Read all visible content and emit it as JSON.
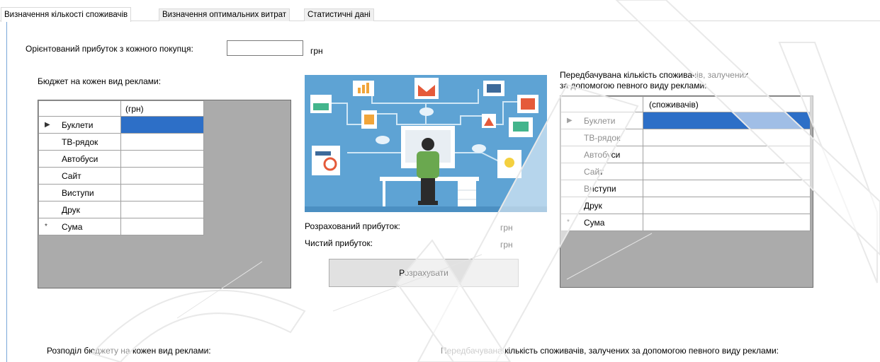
{
  "tabs": [
    {
      "label": "Визначення кількості споживачів",
      "active": true
    },
    {
      "label": "Визначення оптимальних витрат",
      "active": false
    },
    {
      "label": "Статистичні дані",
      "active": false
    }
  ],
  "profit_per_buyer": {
    "label": "Орієнтований прибуток з кожного покупця:",
    "value": "",
    "unit": "грн"
  },
  "budget_grid": {
    "title": "Бюджет на кожен вид реклами:",
    "column_header": "(грн)",
    "rows": [
      {
        "marker": "▶",
        "label": "Буклети",
        "value": "",
        "selected": true
      },
      {
        "marker": "",
        "label": "ТВ-рядок",
        "value": ""
      },
      {
        "marker": "",
        "label": "Автобуси",
        "value": ""
      },
      {
        "marker": "",
        "label": "Сайт",
        "value": ""
      },
      {
        "marker": "",
        "label": "Виступи",
        "value": ""
      },
      {
        "marker": "",
        "label": "Друк",
        "value": ""
      },
      {
        "marker": "*",
        "label": "Сума",
        "value": ""
      }
    ]
  },
  "consumers_grid": {
    "title_line1": "Передбачувана кількість споживачів, залучених",
    "title_line2": "за допомогою певного виду реклами:",
    "column_header": "(споживачів)",
    "rows": [
      {
        "marker": "▶",
        "label": "Буклети",
        "value": "",
        "selected": true
      },
      {
        "marker": "",
        "label": "ТВ-рядок",
        "value": ""
      },
      {
        "marker": "",
        "label": "Автобуси",
        "value": ""
      },
      {
        "marker": "",
        "label": "Сайт",
        "value": ""
      },
      {
        "marker": "",
        "label": "Виступи",
        "value": ""
      },
      {
        "marker": "",
        "label": "Друк",
        "value": ""
      },
      {
        "marker": "*",
        "label": "Сума",
        "value": ""
      }
    ]
  },
  "results": {
    "calculated_profit_label": "Розрахований прибуток:",
    "calculated_profit_unit": "грн",
    "net_profit_label": "Чистий прибуток:",
    "net_profit_unit": "грн"
  },
  "calculate_button": "Розрахувати",
  "bottom": {
    "budget_distribution_label": "Розподіл бюджету на кожен вид реклами:",
    "consumers_label": "Передбачувана кількість споживачів, залучених за допомогою певного виду реклами:"
  },
  "watermark": "ОЛА",
  "colors": {
    "selection": "#2d6fc7",
    "grid_background": "#ababab",
    "illustration_background": "#5ea3d4",
    "button_background": "#e1e1e1"
  }
}
